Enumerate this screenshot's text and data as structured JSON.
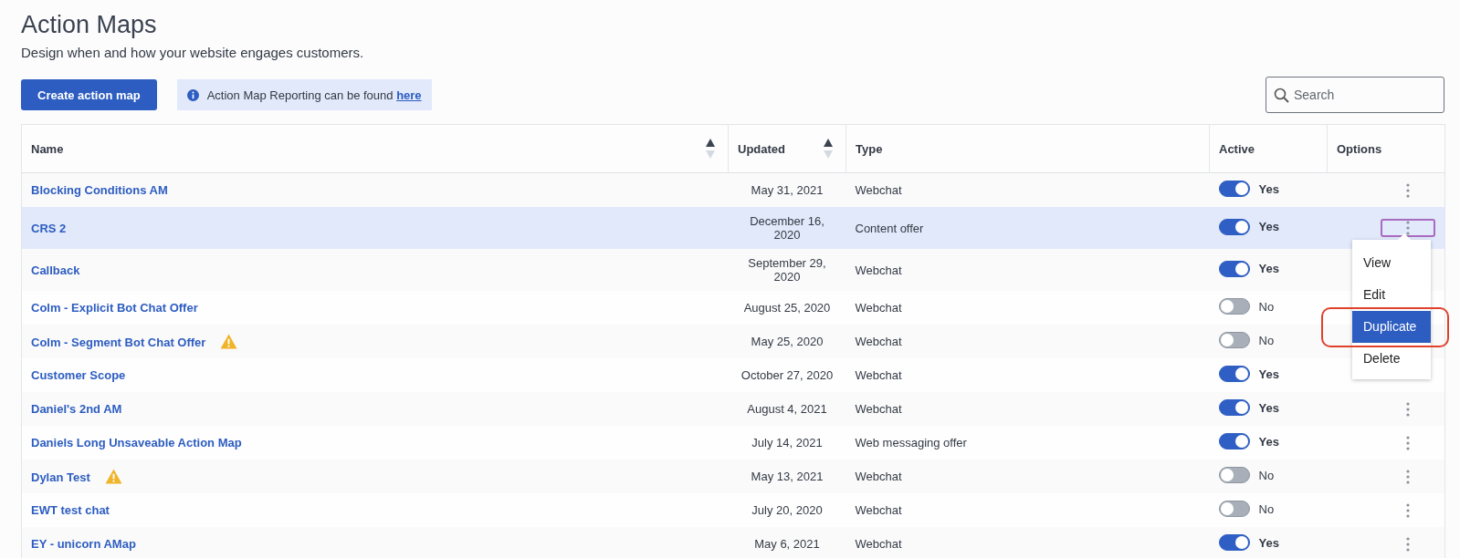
{
  "header": {
    "title": "Action Maps",
    "subtitle": "Design when and how your website engages customers."
  },
  "toolbar": {
    "create_button": "Create action map",
    "info_text": "Action Map Reporting can be found ",
    "info_link": "here",
    "search": {
      "placeholder": "Search"
    }
  },
  "table": {
    "columns": [
      {
        "label": "Name",
        "sortable": true
      },
      {
        "label": "Updated",
        "sortable": true
      },
      {
        "label": "Type",
        "sortable": false
      },
      {
        "label": "Active",
        "sortable": false
      },
      {
        "label": "Options",
        "sortable": false
      }
    ],
    "rows": [
      {
        "name": "Blocking Conditions AM",
        "warning": false,
        "updated": "May 31, 2021",
        "type": "Webchat",
        "active": true,
        "active_label": "Yes",
        "selected": false
      },
      {
        "name": "CRS 2",
        "warning": false,
        "updated": "December 16, 2020",
        "type": "Content offer",
        "active": true,
        "active_label": "Yes",
        "selected": true,
        "menu": [
          {
            "label": "View",
            "selected": false,
            "circled": false
          },
          {
            "label": "Edit",
            "selected": false,
            "circled": false
          },
          {
            "label": "Duplicate",
            "selected": true,
            "circled": true
          },
          {
            "label": "Delete",
            "selected": false,
            "circled": false
          }
        ]
      },
      {
        "name": "Callback",
        "warning": false,
        "updated": "September 29, 2020",
        "type": "Webchat",
        "active": true,
        "active_label": "Yes",
        "selected": false
      },
      {
        "name": "Colm - Explicit Bot Chat Offer",
        "warning": false,
        "updated": "August 25, 2020",
        "type": "Webchat",
        "active": false,
        "active_label": "No",
        "selected": false
      },
      {
        "name": "Colm - Segment Bot Chat Offer",
        "warning": true,
        "updated": "May 25, 2020",
        "type": "Webchat",
        "active": false,
        "active_label": "No",
        "selected": false
      },
      {
        "name": "Customer Scope",
        "warning": false,
        "updated": "October 27, 2020",
        "type": "Webchat",
        "active": true,
        "active_label": "Yes",
        "selected": false
      },
      {
        "name": "Daniel's 2nd AM",
        "warning": false,
        "updated": "August 4, 2021",
        "type": "Webchat",
        "active": true,
        "active_label": "Yes",
        "selected": false
      },
      {
        "name": "Daniels Long Unsaveable Action Map",
        "warning": false,
        "updated": "July 14, 2021",
        "type": "Web messaging offer",
        "active": true,
        "active_label": "Yes",
        "selected": false
      },
      {
        "name": "Dylan Test",
        "warning": true,
        "updated": "May 13, 2021",
        "type": "Webchat",
        "active": false,
        "active_label": "No",
        "selected": false
      },
      {
        "name": "EWT test chat",
        "warning": false,
        "updated": "July 20, 2020",
        "type": "Webchat",
        "active": false,
        "active_label": "No",
        "selected": false
      },
      {
        "name": "EY - unicorn AMap",
        "warning": false,
        "updated": "May 6, 2021",
        "type": "Webchat",
        "active": true,
        "active_label": "Yes",
        "selected": false
      }
    ]
  }
}
